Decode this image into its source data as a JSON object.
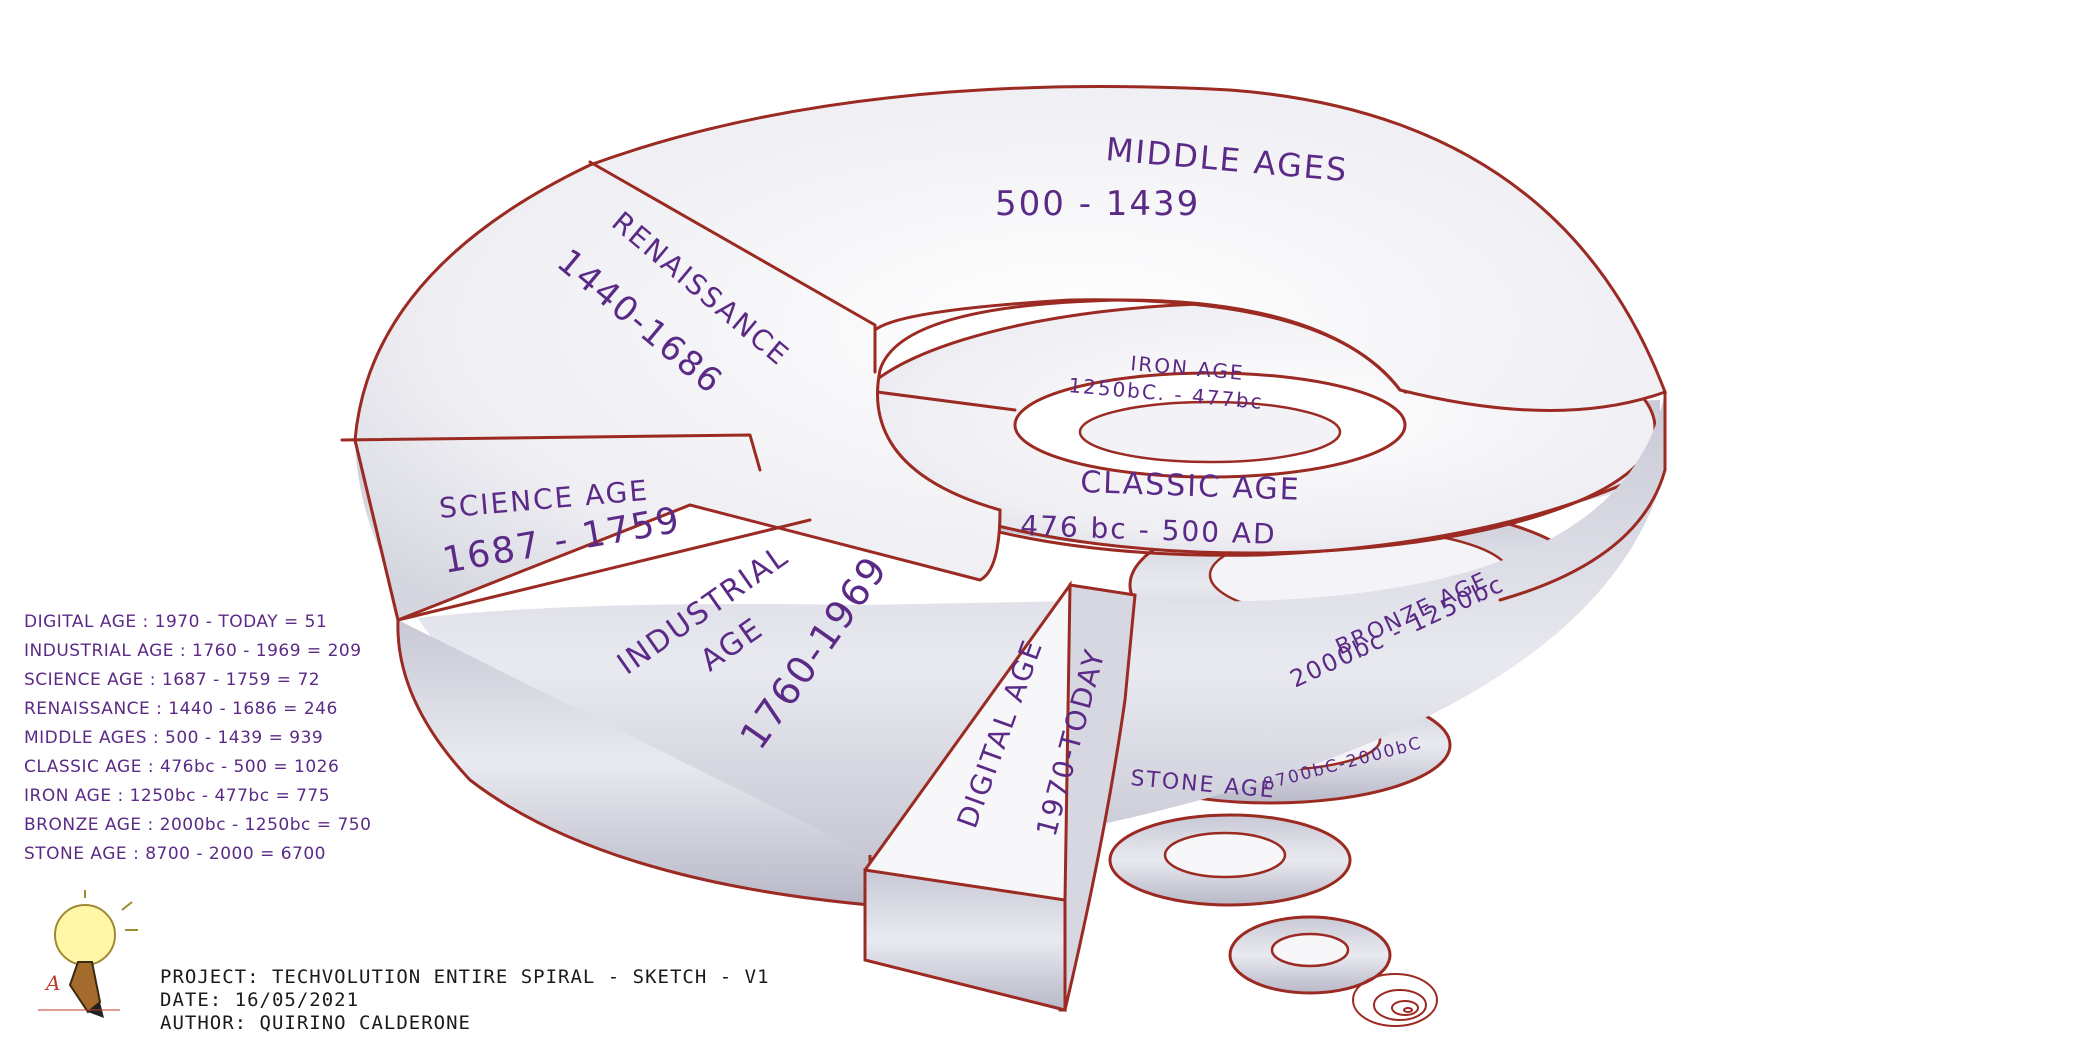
{
  "diagram": {
    "segments": [
      {
        "name": "MIDDLE AGES",
        "years": "500 - 1439"
      },
      {
        "name": "RENAISSANCE",
        "years": "1440-1686"
      },
      {
        "name": "SCIENCE AGE",
        "years": "1687 - 1759"
      },
      {
        "name": "INDUSTRIAL AGE",
        "years": "1760-1969"
      },
      {
        "name": "DIGITAL AGE",
        "years": "1970-TODAY"
      },
      {
        "name": "IRON AGE",
        "years": "1250bC. - 477bc"
      },
      {
        "name": "CLASSIC AGE",
        "years": "476 bc - 500 AD"
      },
      {
        "name": "BRONZE AGE",
        "years": "2000bc - 1250bc"
      },
      {
        "name": "STONE AGE",
        "years": "8700bC-2000bC"
      }
    ]
  },
  "legend": [
    "DIGITAL AGE : 1970 - TODAY = 51",
    "INDUSTRIAL AGE : 1760 - 1969 = 209",
    "SCIENCE AGE : 1687 - 1759 = 72",
    "RENAISSANCE : 1440 - 1686 = 246",
    "MIDDLE AGES : 500 - 1439 = 939",
    "CLASSIC AGE : 476bc - 500 = 1026",
    "IRON AGE : 1250bc - 477bc = 775",
    "BRONZE AGE : 2000bc - 1250bc = 750",
    "STONE AGE : 8700 - 2000 = 6700"
  ],
  "meta": {
    "project": "PROJECT: TECHVOLUTION ENTIRE SPIRAL - SKETCH - V1",
    "date": "DATE: 16/05/2021",
    "author": "AUTHOR: QUIRINO CALDERONE"
  },
  "colors": {
    "outline": "#9b2a22",
    "text": "#5b2a86",
    "shade": "#d9d9e3"
  },
  "icons": {
    "logo": "lightbulb-pencil-icon"
  }
}
